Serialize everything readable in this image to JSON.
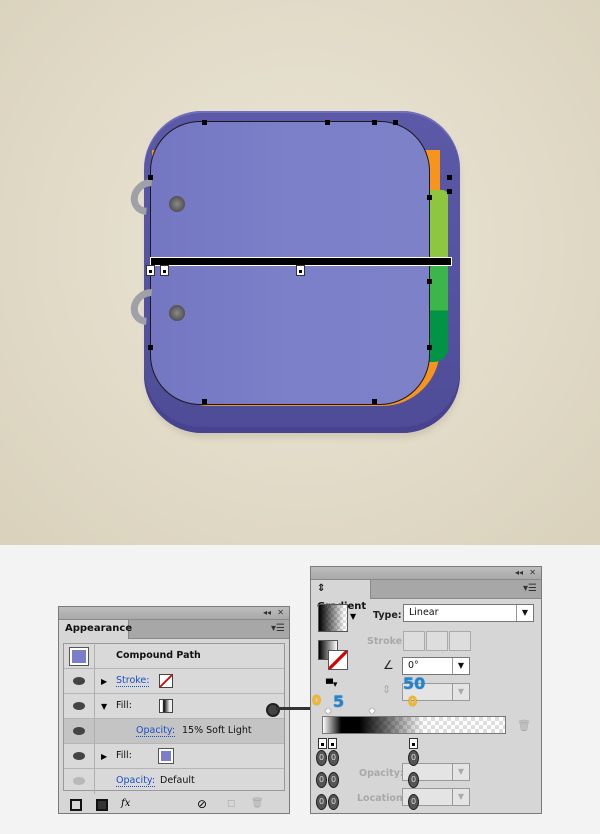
{
  "artwork": {
    "description": "Notebook app icon with selected compound path and gradient annotator",
    "colors": {
      "base": "#524f9c",
      "page": "#7a7ec6",
      "orange_edge": "#f7941d",
      "tab_light": "#8dc63f",
      "tab_mid": "#3cb54a",
      "tab_dark": "#009444",
      "background": "#e2dbc8"
    }
  },
  "appearance_panel": {
    "title_controls": {
      "collapse": "◂◂",
      "close": "✕"
    },
    "tab_label": "Appearance",
    "menu_icon": "▾☰",
    "header": {
      "swatch_color": "#7b7fc9",
      "title": "Compound Path"
    },
    "rows": [
      {
        "label": "Stroke:",
        "expander": "▶",
        "swatch": "none-stroke",
        "link": true
      },
      {
        "label": "Fill:",
        "expander": "▼",
        "swatch": "gradient-fill",
        "link": false
      },
      {
        "label": "Opacity:",
        "value": "15% Soft Light",
        "link": true,
        "selected": true
      },
      {
        "label": "Fill:",
        "expander": "▶",
        "swatch_color": "#7b7fc9",
        "link": false
      },
      {
        "label": "Opacity:",
        "value": "Default",
        "link": true
      }
    ],
    "bottom_icons": [
      "add-new-stroke-icon",
      "add-new-fill-icon",
      "fx-icon",
      "clear-appearance-icon",
      "duplicate-item-icon",
      "delete-item-icon"
    ],
    "fx_label": "fx"
  },
  "gradient_panel": {
    "title_controls": {
      "collapse": "◂◂",
      "close": "✕"
    },
    "tab_label": "Gradient",
    "tab_prefix": "⇕",
    "menu_icon": "▾☰",
    "type_label": "Type:",
    "type_value": "Linear",
    "stroke_label": "Stroke:",
    "angle_value": "0°",
    "aspect_value": "",
    "opacity_label": "Opacity:",
    "location_label": "Location:",
    "stops": [
      {
        "color": "#ffffff",
        "opacity": "0%",
        "location": "0%"
      },
      {
        "color": "#000000",
        "opacity": "100%",
        "location": "5%"
      },
      {
        "color": "#000000",
        "opacity": "0%",
        "location": "50%"
      }
    ],
    "callouts": {
      "first_stop_opacity": "0",
      "second_stop_location": "5",
      "third_stop_location": "50",
      "third_stop_opacity": "0"
    },
    "stop_badges": [
      "0",
      "0",
      "0",
      "0",
      "0",
      "0",
      "0",
      "0",
      "0"
    ]
  }
}
